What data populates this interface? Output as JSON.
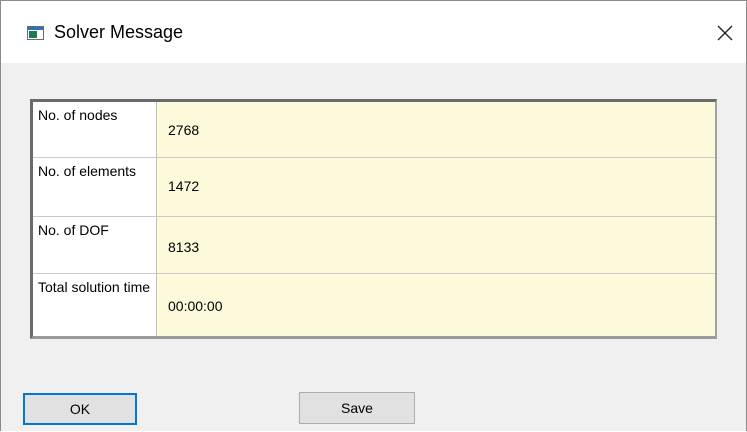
{
  "window": {
    "title": "Solver Message",
    "close_icon": "close-icon",
    "app_icon": "solver-window-icon"
  },
  "results": {
    "rows": [
      {
        "label": "No. of nodes",
        "value": "2768"
      },
      {
        "label": "No. of elements",
        "value": "1472"
      },
      {
        "label": "No. of DOF",
        "value": "8133"
      },
      {
        "label": "Total solution time",
        "value": "00:00:00"
      }
    ]
  },
  "buttons": {
    "ok_label": "OK",
    "save_label": "Save"
  },
  "colors": {
    "value_cell_bg": "#fcfadb",
    "dialog_bg": "#f0f0f0",
    "default_button_border": "#0078d7"
  }
}
